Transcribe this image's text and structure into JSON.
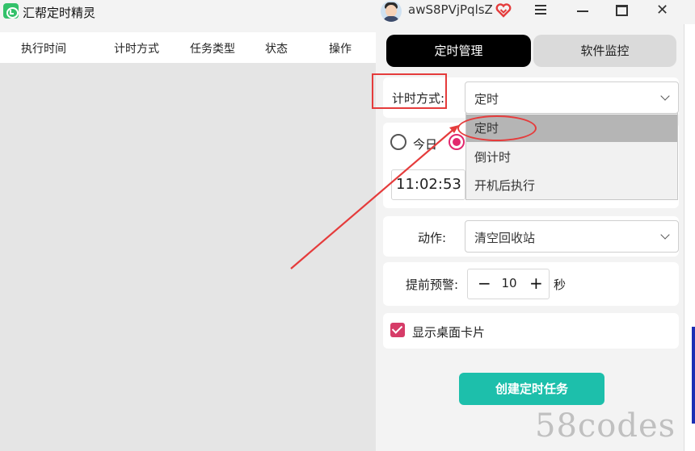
{
  "window": {
    "title": "汇帮定时精灵",
    "username": "awS8PVjPqlsZ"
  },
  "table": {
    "columns": [
      "执行时间",
      "计时方式",
      "任务类型",
      "状态",
      "操作"
    ]
  },
  "tabs": {
    "active": "定时管理",
    "inactive": "软件监控"
  },
  "timer_mode": {
    "label": "计时方式:",
    "selected": "定时",
    "options": [
      "定时",
      "倒计时",
      "开机后执行"
    ]
  },
  "date_options": {
    "today": "今日"
  },
  "time": {
    "value": "11:02:53"
  },
  "action": {
    "label": "动作:",
    "value": "清空回收站"
  },
  "warning": {
    "label": "提前预警:",
    "minus": "−",
    "value": "10",
    "plus": "+",
    "unit": "秒"
  },
  "desktop_card": {
    "label": "显示桌面卡片",
    "checked": true
  },
  "create_button": {
    "label": "创建定时任务"
  },
  "watermark": "58codes",
  "colors": {
    "accent_red": "#e53c3c",
    "teal": "#1dbfab",
    "pink": "#e2286e"
  }
}
